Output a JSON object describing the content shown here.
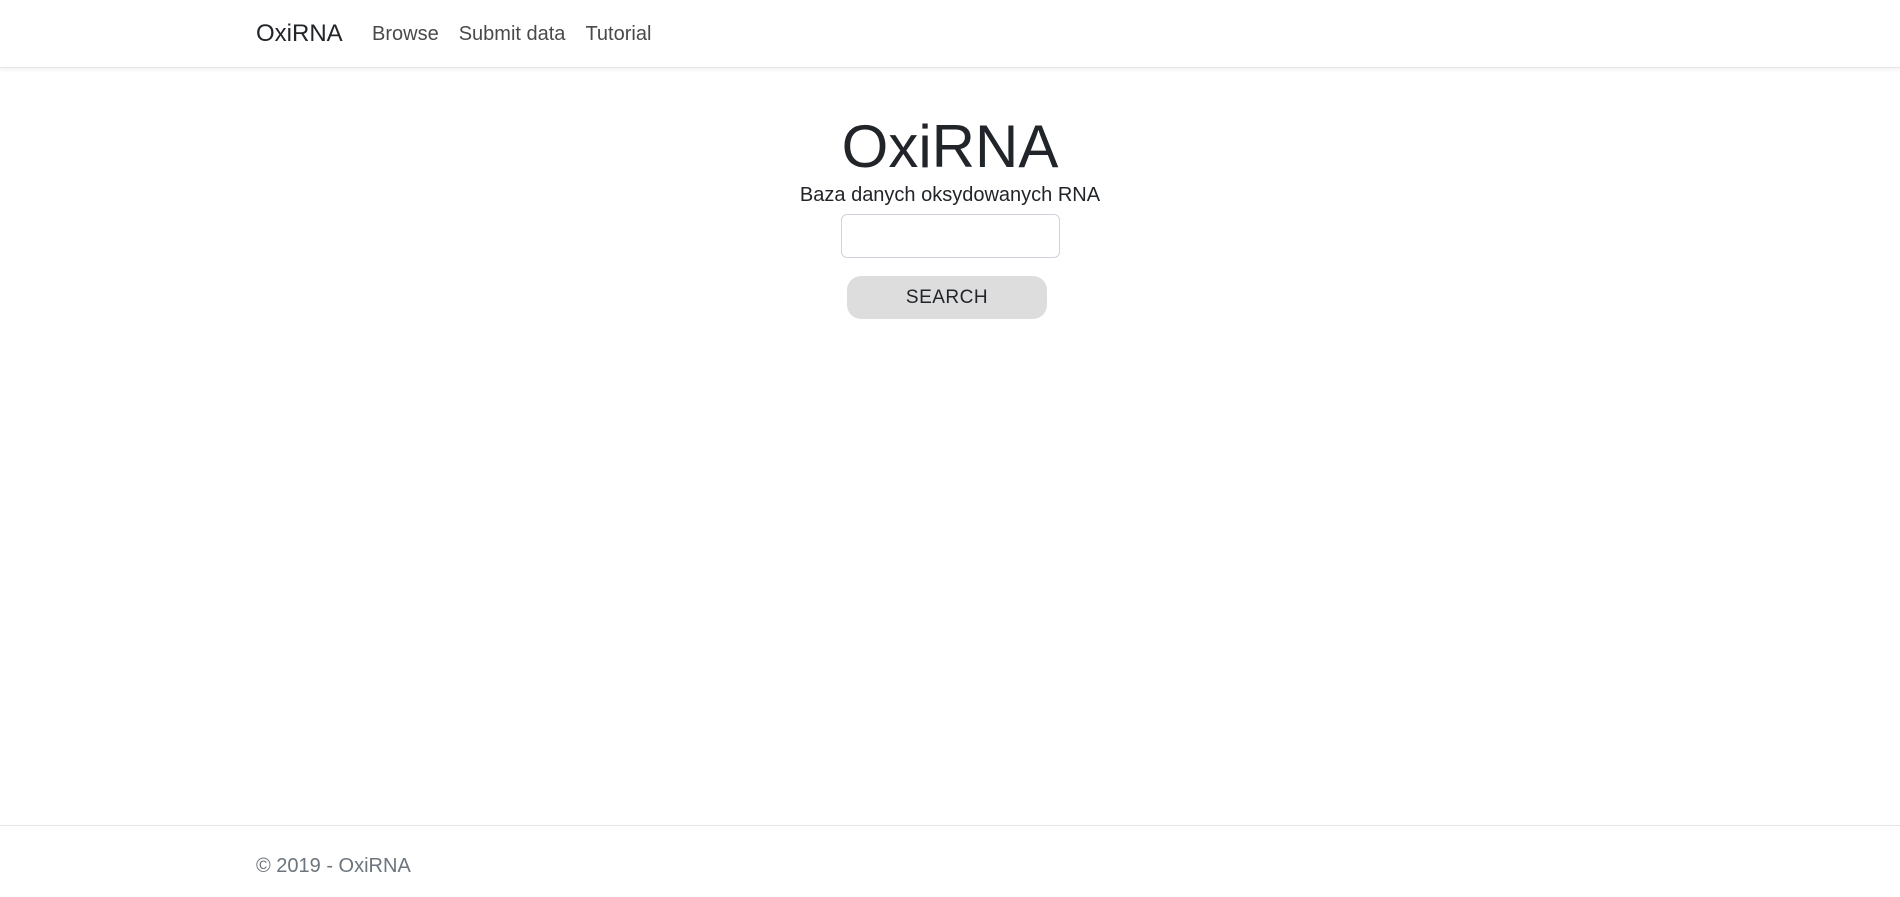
{
  "navbar": {
    "brand": "OxiRNA",
    "links": [
      {
        "label": "Browse"
      },
      {
        "label": "Submit data"
      },
      {
        "label": "Tutorial"
      }
    ]
  },
  "main": {
    "title": "OxiRNA",
    "subtitle": "Baza danych oksydowanych RNA",
    "search": {
      "value": "",
      "placeholder": ""
    },
    "search_button_label": "SEARCH"
  },
  "footer": {
    "text": "© 2019 - OxiRNA"
  }
}
